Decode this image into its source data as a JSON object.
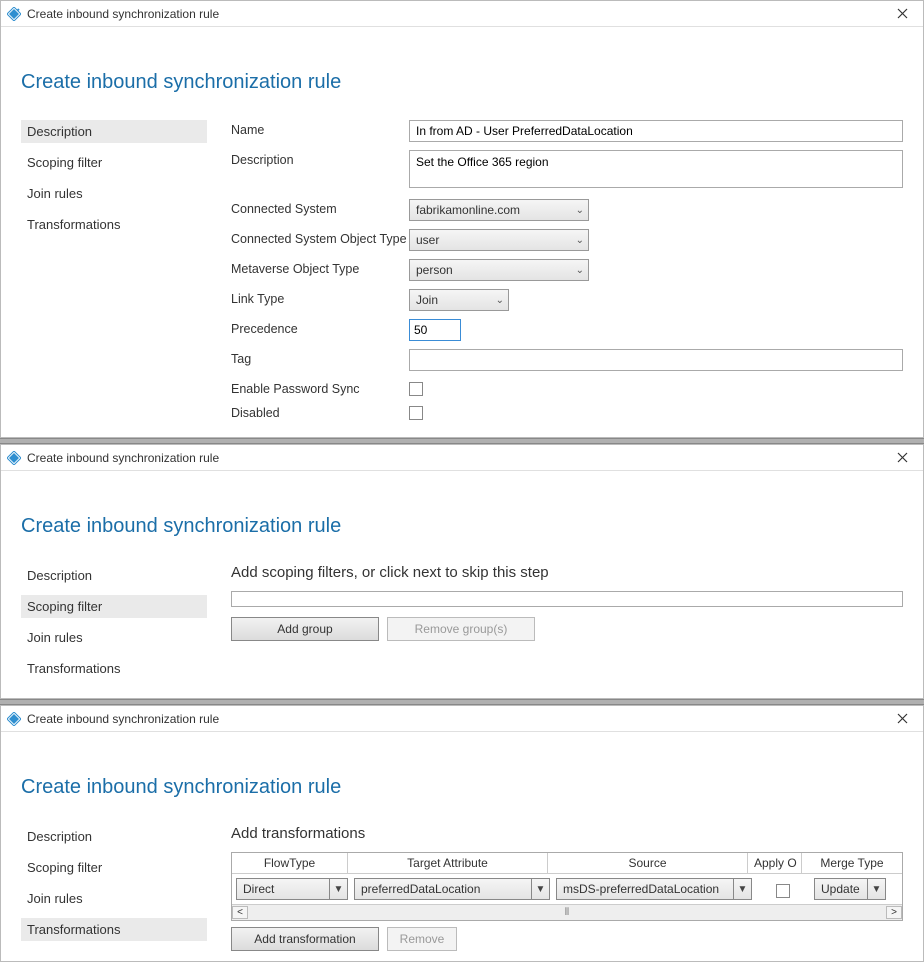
{
  "window_title": "Create inbound synchronization rule",
  "page_heading": "Create inbound synchronization rule",
  "nav": {
    "items": [
      {
        "label": "Description"
      },
      {
        "label": "Scoping filter"
      },
      {
        "label": "Join rules"
      },
      {
        "label": "Transformations"
      }
    ]
  },
  "panel1": {
    "selected_nav_index": 0,
    "fields": {
      "name_label": "Name",
      "name_value": "In from AD - User PreferredDataLocation",
      "description_label": "Description",
      "description_value": "Set the Office 365 region",
      "connected_system_label": "Connected System",
      "connected_system_value": "fabrikamonline.com",
      "cs_object_type_label": "Connected System Object Type",
      "cs_object_type_value": "user",
      "mv_object_type_label": "Metaverse Object Type",
      "mv_object_type_value": "person",
      "link_type_label": "Link Type",
      "link_type_value": "Join",
      "precedence_label": "Precedence",
      "precedence_value": "50",
      "tag_label": "Tag",
      "tag_value": "",
      "enable_password_sync_label": "Enable Password Sync",
      "disabled_label": "Disabled"
    }
  },
  "panel2": {
    "selected_nav_index": 1,
    "instruction": "Add scoping filters, or click next to skip this step",
    "buttons": {
      "add_group": "Add group",
      "remove_groups": "Remove group(s)"
    }
  },
  "panel3": {
    "selected_nav_index": 3,
    "instruction": "Add transformations",
    "headers": {
      "flowtype": "FlowType",
      "target_attribute": "Target Attribute",
      "source": "Source",
      "apply_once": "Apply O",
      "merge_type": "Merge Type"
    },
    "row": {
      "flowtype": "Direct",
      "target_attribute": "preferredDataLocation",
      "source": "msDS-preferredDataLocation",
      "apply_once_checked": false,
      "merge_type": "Update"
    },
    "buttons": {
      "add_transformation": "Add transformation",
      "remove": "Remove"
    },
    "scroll": {
      "left": "<",
      "right": ">"
    }
  }
}
